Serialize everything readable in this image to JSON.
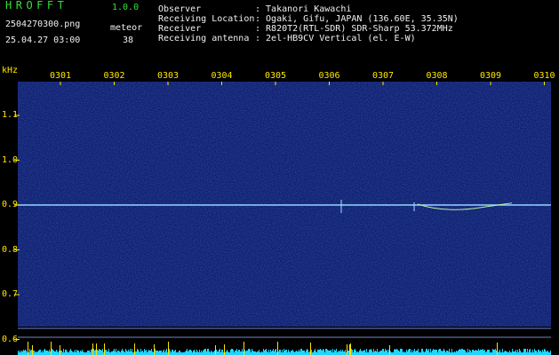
{
  "app": {
    "logo": "HROFFT",
    "version": "1.0.0"
  },
  "file": {
    "name": "2504270300.png",
    "timestamp": "25.04.27 03:00"
  },
  "meteor": {
    "label": "meteor",
    "count": "38"
  },
  "info": [
    {
      "key": "Observer",
      "value": ": Takanori Kawachi"
    },
    {
      "key": "Receiving Location",
      "value": ": Ogaki, Gifu, JAPAN (136.60E, 35.35N)"
    },
    {
      "key": "Receiver",
      "value": ": R820T2(RTL-SDR) SDR-Sharp 53.372MHz"
    },
    {
      "key": "Receiving antenna",
      "value": ": 2el-HB9CV Vertical (el. E-W)"
    }
  ],
  "axis": {
    "unit": "kHz",
    "x_ticks": [
      "0301",
      "0302",
      "0303",
      "0304",
      "0305",
      "0306",
      "0307",
      "0308",
      "0309",
      "0310"
    ],
    "y_ticks": [
      "1.1",
      "1.0",
      "0.9",
      "0.8",
      "0.7",
      "0.6"
    ]
  },
  "colors": {
    "label": "#ffe600",
    "title": "#35e035",
    "background": "#000000",
    "signal": "#8fd8ff"
  }
}
